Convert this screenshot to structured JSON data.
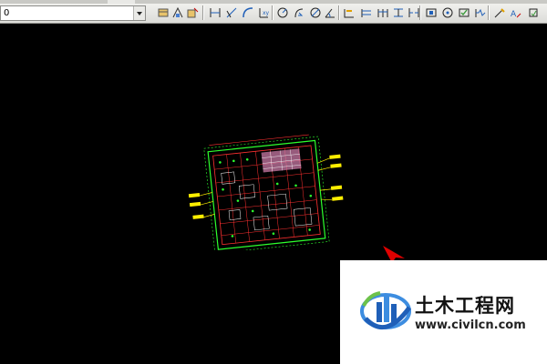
{
  "toolbar": {
    "layer_value": "0",
    "icons": [
      "layer-state-icon",
      "match-properties-icon",
      "layer-previous-icon",
      "linear-dimension-icon",
      "aligned-dimension-icon",
      "arc-length-icon",
      "ordinate-dimension-icon",
      "radius-dimension-icon",
      "jogged-radius-icon",
      "diameter-dimension-icon",
      "angular-dimension-icon",
      "quick-dimension-icon",
      "baseline-dimension-icon",
      "continue-dimension-icon",
      "dimension-space-icon",
      "dimension-break-icon",
      "tolerance-icon",
      "center-mark-icon",
      "inspect-icon",
      "jogged-linear-icon",
      "dimension-edit-icon",
      "dimension-text-edit-icon",
      "dimension-update-icon"
    ]
  },
  "canvas": {
    "background": "#000000",
    "drawing_colors": {
      "green": "#2dff2d",
      "red": "#ff3030",
      "yellow": "#ffee00",
      "white": "#ffffff",
      "magenta": "#ff66cc"
    },
    "cursor_color": "#e00000"
  },
  "watermark": {
    "title": "土木工程网",
    "url": "www.civilcn.com",
    "logo_colors": {
      "blue": "#1f5fb8",
      "light_blue": "#3d8de0",
      "green": "#6cc24a"
    }
  }
}
